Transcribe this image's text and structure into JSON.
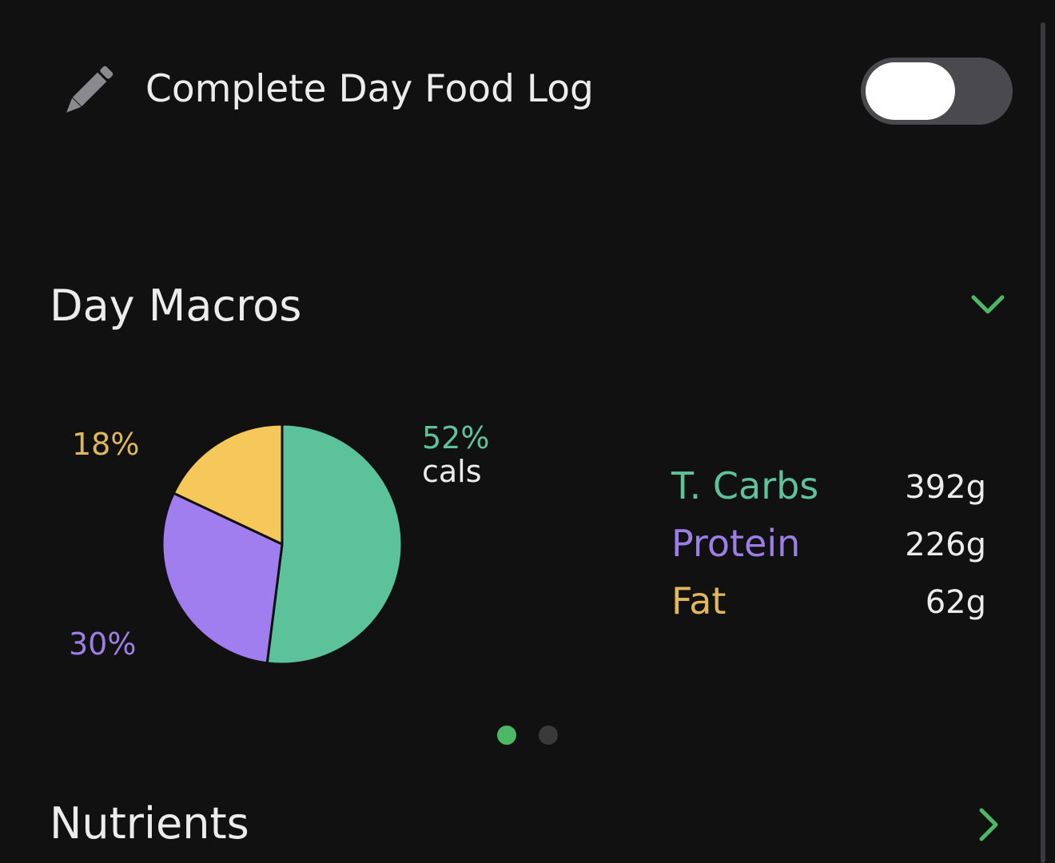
{
  "food_log": {
    "title": "Complete Day Food Log",
    "toggle_on": false,
    "icon": "pencil-icon"
  },
  "macros_section": {
    "title": "Day Macros",
    "expand_icon": "chevron-down-icon"
  },
  "pie_labels": {
    "fat_pct": "18%",
    "protein_pct": "30%",
    "carbs_pct": "52%",
    "cals": "cals"
  },
  "macros": [
    {
      "name": "T. Carbs",
      "value": "392g",
      "color": "#5ec29a"
    },
    {
      "name": "Protein",
      "value": "226g",
      "color": "#9b7fe6"
    },
    {
      "name": "Fat",
      "value": "62g",
      "color": "#e0b85a"
    }
  ],
  "chart_data": {
    "type": "pie",
    "slices": [
      {
        "label": "T. Carbs",
        "value": 52,
        "color": "#5bc29a"
      },
      {
        "label": "Protein",
        "value": 30,
        "color": "#a07ef0"
      },
      {
        "label": "Fat",
        "value": 18,
        "color": "#f6c85a"
      }
    ]
  },
  "pagination": {
    "pages": 2,
    "current": 1,
    "active_color": "#4cb866",
    "inactive_color": "#3a3a3c"
  },
  "nutrients_section": {
    "title": "Nutrients",
    "nav_icon": "chevron-right-icon"
  },
  "colors": {
    "accent": "#4cb866",
    "background": "#111111",
    "text": "#ececec"
  }
}
